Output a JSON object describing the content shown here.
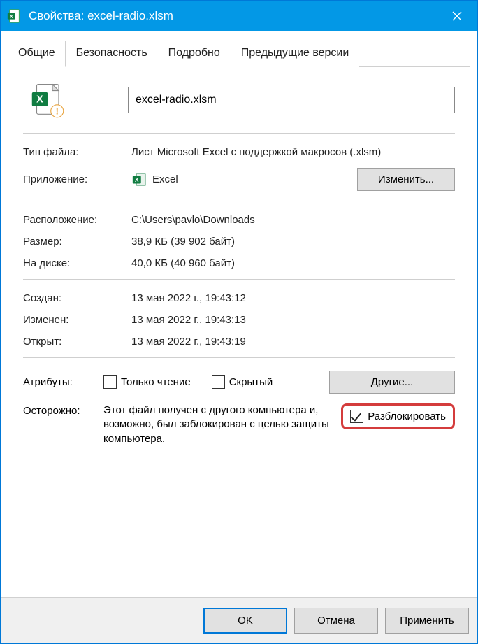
{
  "titlebar": {
    "title": "Свойства: excel-radio.xlsm"
  },
  "tabs": {
    "general": "Общие",
    "security": "Безопасность",
    "details": "Подробно",
    "previous": "Предыдущие версии"
  },
  "file": {
    "name": "excel-radio.xlsm"
  },
  "labels": {
    "filetype": "Тип файла:",
    "app": "Приложение:",
    "location": "Расположение:",
    "size": "Размер:",
    "ondisk": "На диске:",
    "created": "Создан:",
    "modified": "Изменен:",
    "accessed": "Открыт:",
    "attributes": "Атрибуты:",
    "readonly": "Только чтение",
    "hidden": "Скрытый",
    "caution": "Осторожно:",
    "unblock": "Разблокировать"
  },
  "values": {
    "filetype": "Лист Microsoft Excel с поддержкой макросов (.xlsm)",
    "app": "Excel",
    "location": "C:\\Users\\pavlo\\Downloads",
    "size": "38,9 КБ (39 902 байт)",
    "ondisk": "40,0 КБ (40 960 байт)",
    "created": "13 мая 2022 г., 19:43:12",
    "modified": "13 мая 2022 г., 19:43:13",
    "accessed": "13 мая 2022 г., 19:43:19",
    "security_text": "Этот файл получен с другого компьютера и, возможно, был заблокирован с целью защиты компьютера."
  },
  "buttons": {
    "change": "Изменить...",
    "other": "Другие...",
    "ok": "OK",
    "cancel": "Отмена",
    "apply": "Применить"
  }
}
